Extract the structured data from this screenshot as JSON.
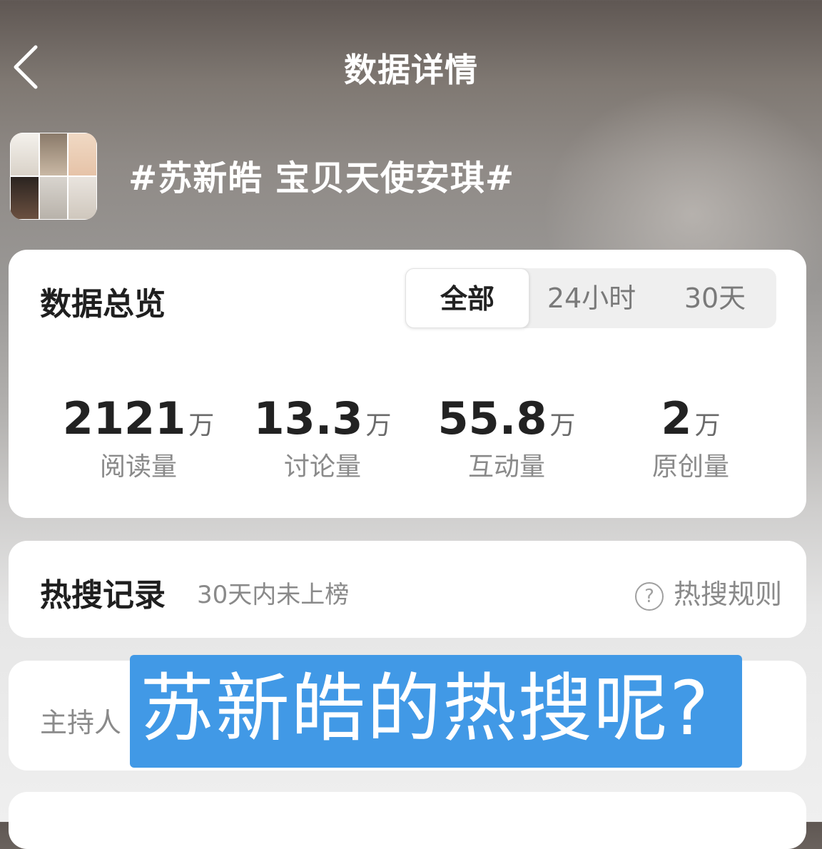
{
  "nav": {
    "title": "数据详情",
    "back_icon": "chevron-left-icon"
  },
  "topic": {
    "title": "#苏新皓 宝贝天使安琪#"
  },
  "overview": {
    "heading": "数据总览",
    "tabs": [
      {
        "label": "全部",
        "active": true
      },
      {
        "label": "24小时",
        "active": false
      },
      {
        "label": "30天",
        "active": false
      }
    ],
    "stats": [
      {
        "value": "2121",
        "unit": "万",
        "label": "阅读量"
      },
      {
        "value": "13.3",
        "unit": "万",
        "label": "讨论量"
      },
      {
        "value": "55.8",
        "unit": "万",
        "label": "互动量"
      },
      {
        "value": "2",
        "unit": "万",
        "label": "原创量"
      }
    ]
  },
  "hot_search": {
    "heading": "热搜记录",
    "subtitle": "30天内未上榜",
    "rules_label": "热搜规则",
    "rules_icon": "help-circle-icon"
  },
  "host": {
    "label": "主持人"
  },
  "overlay_caption": {
    "text": "苏新皓的热搜呢?",
    "background": "#4199e6"
  }
}
